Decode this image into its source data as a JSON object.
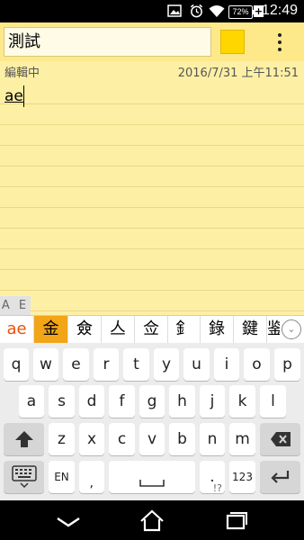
{
  "status_bar": {
    "time": "12:49",
    "battery_percent": "72%",
    "icons": [
      "image-icon",
      "alarm-clock-icon",
      "wifi-icon",
      "no-sim-icon",
      "battery-icon",
      "charging-plus-icon"
    ]
  },
  "note": {
    "title": "測試",
    "status": "編輯中",
    "timestamp": "2016/7/31 上午11:51",
    "body": "ae",
    "color": "#ffd600",
    "overflow_menu": "more-vert-icon"
  },
  "ime": {
    "lang_toggle": "A E",
    "composing": "ae",
    "candidates": [
      "金",
      "僉",
      "亼",
      "佥",
      "釒",
      "錄",
      "鍵",
      "鉴"
    ],
    "selected_index": 0
  },
  "keyboard": {
    "row1": [
      "q",
      "w",
      "e",
      "r",
      "t",
      "y",
      "u",
      "i",
      "o",
      "p"
    ],
    "row2": [
      "a",
      "s",
      "d",
      "f",
      "g",
      "h",
      "j",
      "k",
      "l"
    ],
    "row3": [
      "z",
      "x",
      "c",
      "v",
      "b",
      "n",
      "m"
    ],
    "lang_key": "EN",
    "punct_key": ".",
    "punct_sub": "!?",
    "sub_comma": ",",
    "num_key": "123",
    "shift": "shift-icon",
    "backspace": "backspace-icon",
    "settings": "keyboard-settings-icon",
    "space": "space-icon",
    "enter": "enter-icon"
  },
  "nav_bar": [
    "back-icon",
    "home-icon",
    "recents-icon"
  ]
}
